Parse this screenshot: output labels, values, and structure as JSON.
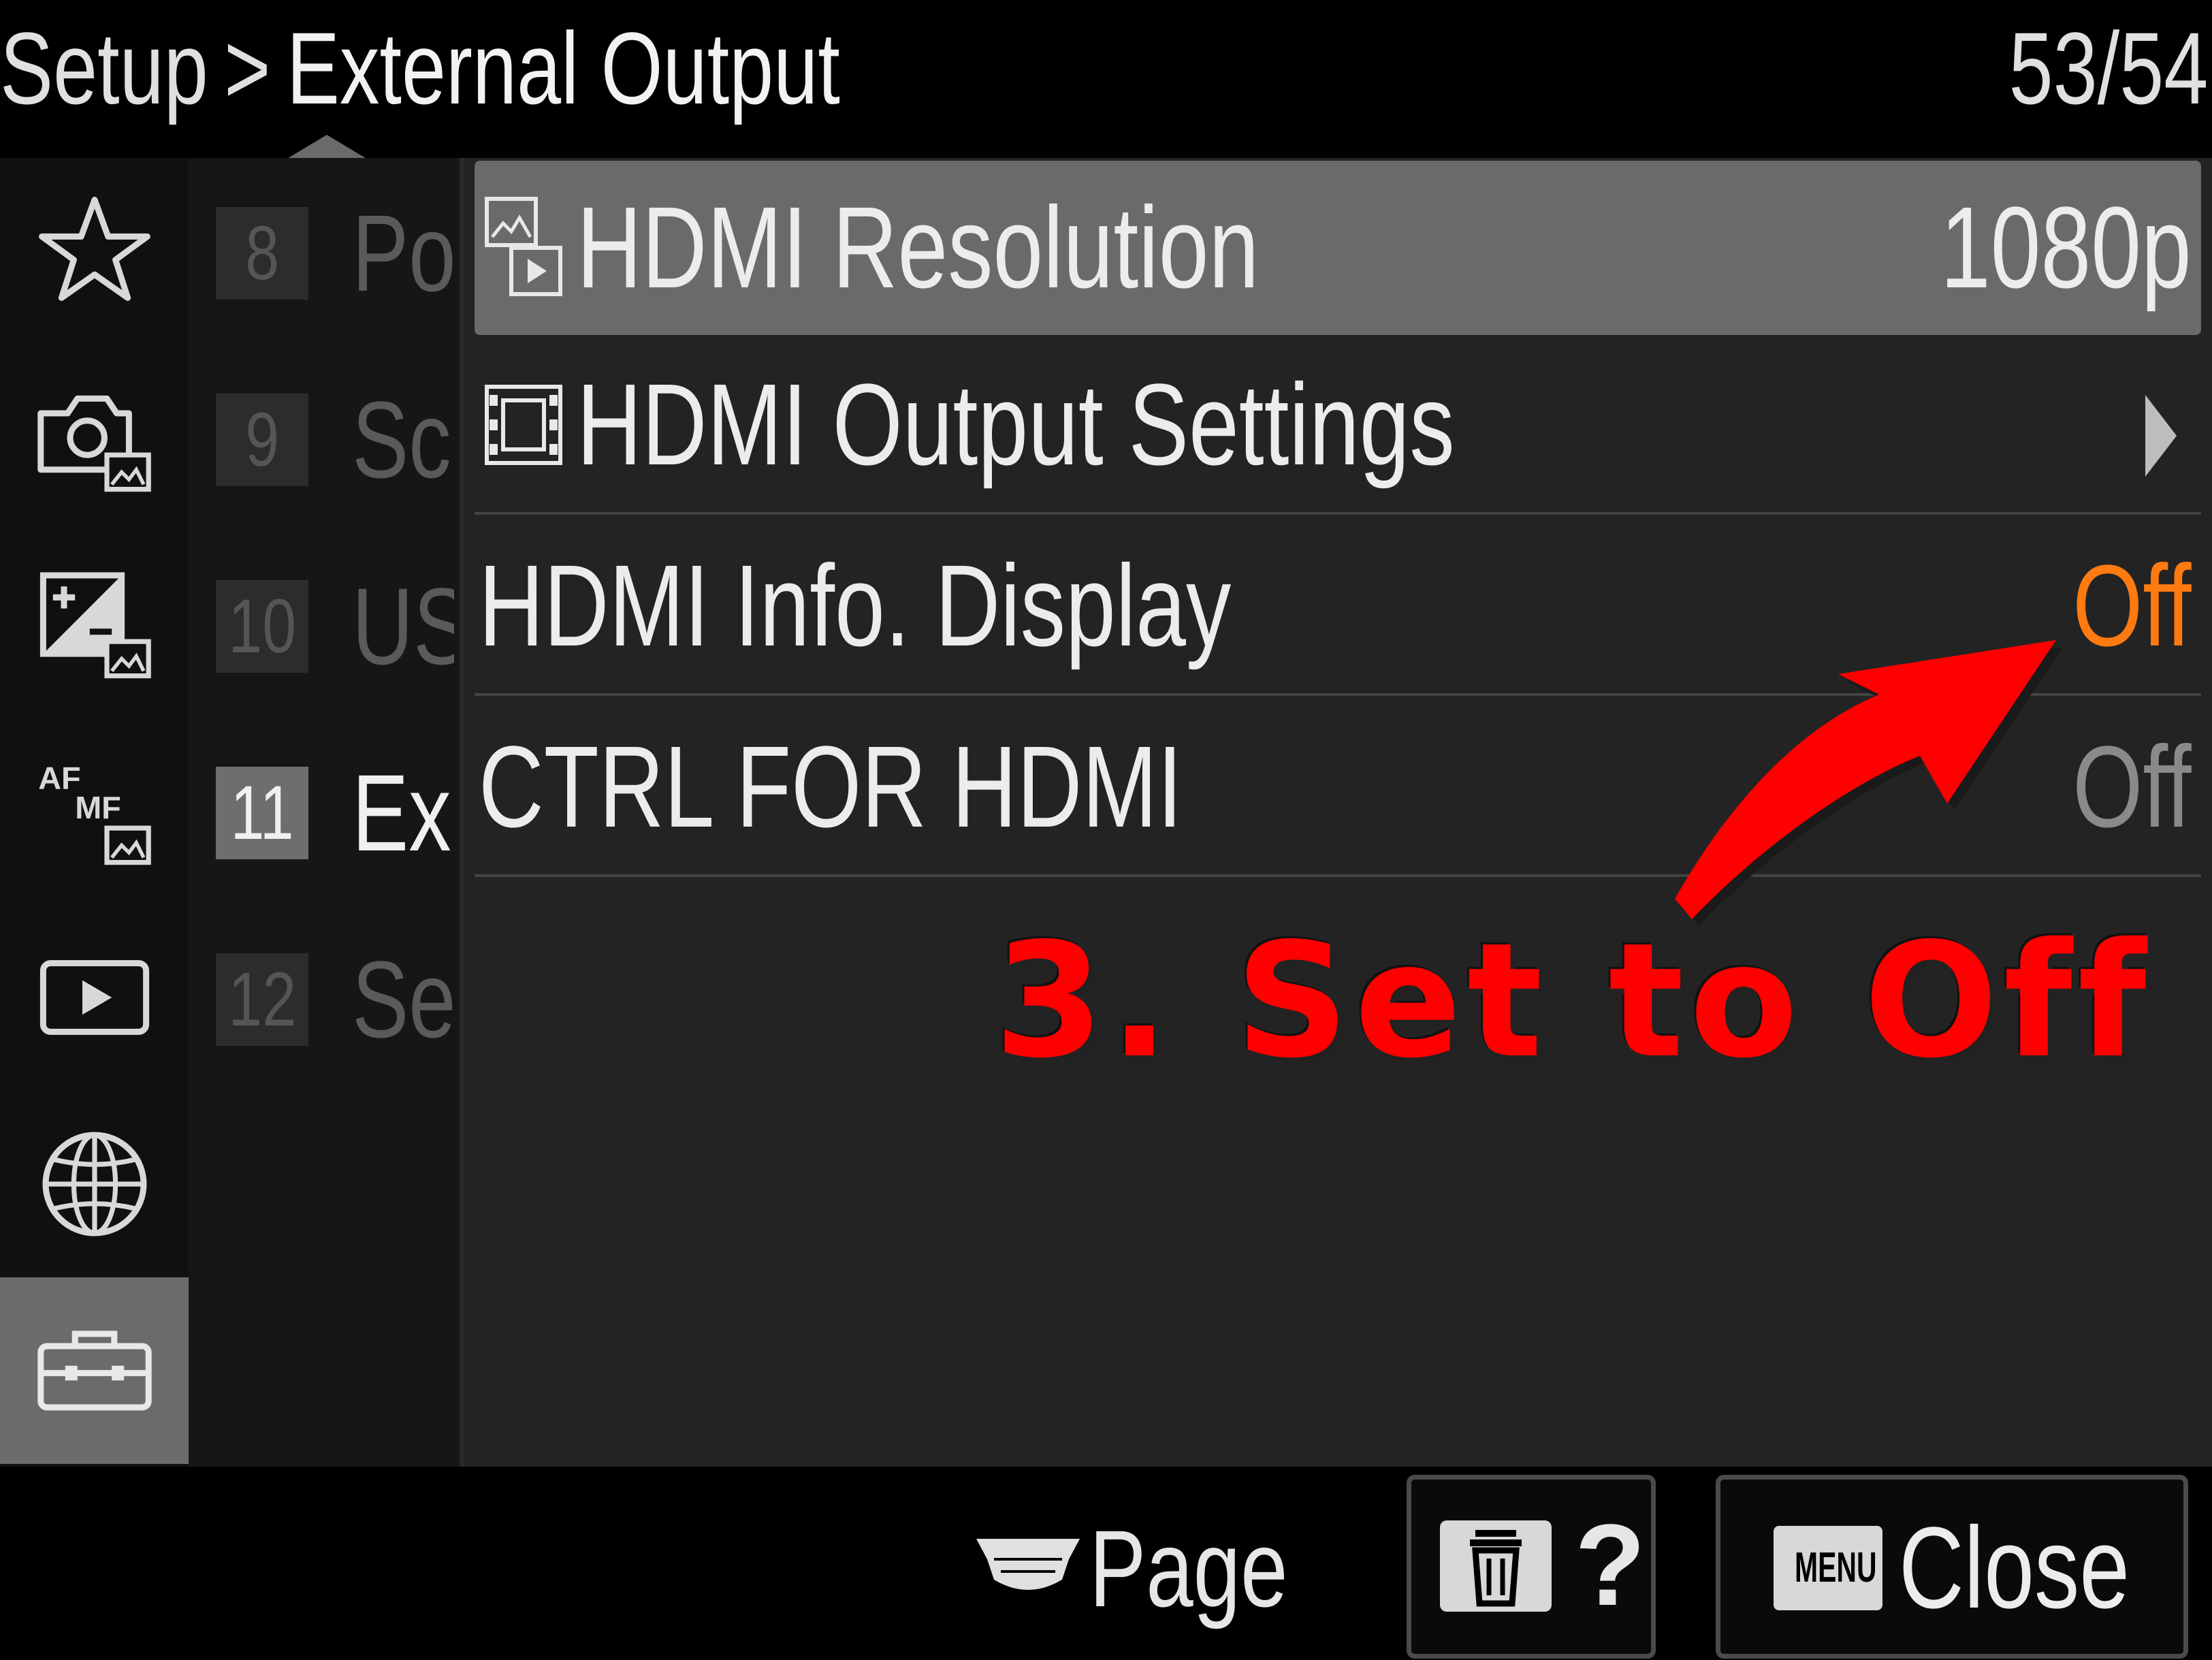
{
  "header": {
    "section": "Setup",
    "separator": ">",
    "current": "External Output",
    "page_counter": "53/54"
  },
  "categories": [
    {
      "icon": "star-icon",
      "selected": false
    },
    {
      "icon": "camera-icon",
      "selected": false
    },
    {
      "icon": "exposure-icon",
      "selected": false
    },
    {
      "icon": "af-mf-icon",
      "af": "AF",
      "mf": "MF",
      "selected": false
    },
    {
      "icon": "playback-icon",
      "selected": false
    },
    {
      "icon": "globe-icon",
      "selected": false
    },
    {
      "icon": "toolbox-icon",
      "selected": true
    }
  ],
  "subgroups": [
    {
      "number": "8",
      "label": "Po",
      "selected": false
    },
    {
      "number": "9",
      "label": "Sc",
      "selected": false
    },
    {
      "number": "10",
      "label": "US",
      "selected": false
    },
    {
      "number": "11",
      "label": "Ex",
      "selected": true
    },
    {
      "number": "12",
      "label": "Se",
      "selected": false
    }
  ],
  "menu_items": [
    {
      "label": "HDMI Resolution",
      "value": "1080p",
      "icon": "movie-still-icon",
      "selected": true
    },
    {
      "label": "HDMI Output Settings",
      "value": "",
      "icon": "film-icon",
      "has_submenu": true
    },
    {
      "label": "HDMI Info. Display",
      "value": "Off",
      "value_color": "#ff7a10"
    },
    {
      "label": "CTRL FOR HDMI",
      "value": "Off",
      "value_color": "#8a8a8a"
    }
  ],
  "annotation": {
    "text": "3. Set to Off",
    "color": "#ff0000"
  },
  "footer": {
    "page_label": "Page",
    "help_label": "?",
    "menu_key": "MENU",
    "close_label": "Close"
  }
}
